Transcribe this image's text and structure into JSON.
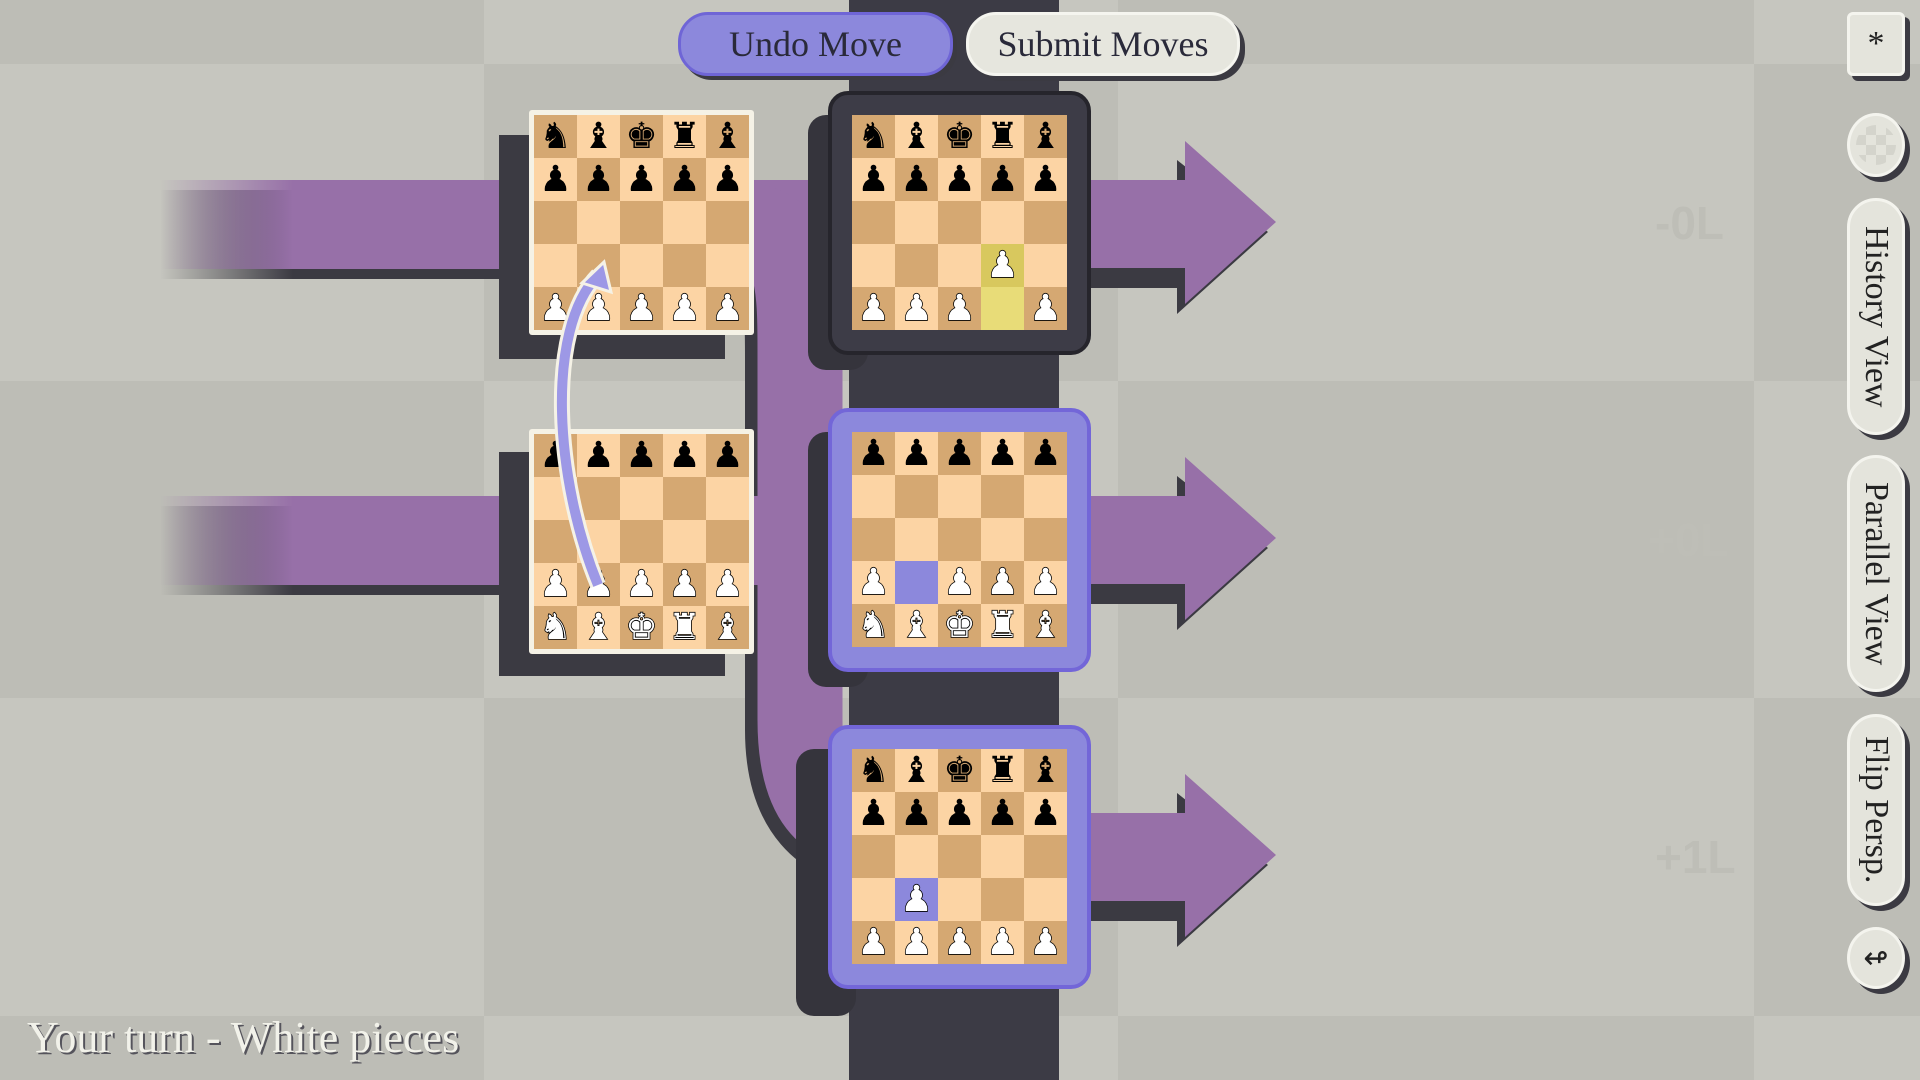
{
  "header": {
    "undo_label": "Undo Move",
    "submit_label": "Submit Moves"
  },
  "sidebar": {
    "asterisk_label": "*",
    "history_label": "History View",
    "parallel_label": "Parallel View",
    "flip_label": "Flip Persp.",
    "back_icon": "back-arrow-icon",
    "circle_icon": "checker-circle-icon"
  },
  "status": {
    "turn_text": "Your turn - White pieces"
  },
  "timelines": [
    {
      "label": "-0L"
    },
    {
      "label": "+0L"
    },
    {
      "label": "+1L"
    }
  ],
  "colors": {
    "light_square": "#fcd4a4",
    "dark_square": "#d5a872",
    "timeline_purple": "#9770a8",
    "selected_purple": "#8c88dc",
    "last_move_from": "#e8dc78",
    "last_move_to": "#d8c85e",
    "active_frame": "#8c88dc",
    "inactive_frame": "#3d3c47"
  },
  "boards": [
    {
      "name": "past-board-top",
      "cells": [
        [
          "bN",
          "bB",
          "bK",
          "bR",
          "bB"
        ],
        [
          "bP",
          "bP",
          "bP",
          "bP",
          "bP"
        ],
        [
          "",
          "",
          "",
          "",
          ""
        ],
        [
          "",
          "",
          "",
          "",
          ""
        ],
        [
          "wP",
          "wP",
          "wP",
          "wP",
          "wP"
        ]
      ],
      "highlights": []
    },
    {
      "name": "past-board-bottom",
      "cells": [
        [
          "bP",
          "bP",
          "bP",
          "bP",
          "bP"
        ],
        [
          "",
          "",
          "",
          "",
          ""
        ],
        [
          "",
          "",
          "",
          "",
          ""
        ],
        [
          "wP",
          "wP",
          "wP",
          "wP",
          "wP"
        ],
        [
          "wN",
          "wB",
          "wK",
          "wR",
          "wB"
        ]
      ],
      "highlights": []
    },
    {
      "name": "present-board-minus0",
      "cells": [
        [
          "bN",
          "bB",
          "bK",
          "bR",
          "bB"
        ],
        [
          "bP",
          "bP",
          "bP",
          "bP",
          "bP"
        ],
        [
          "",
          "",
          "",
          "",
          ""
        ],
        [
          "",
          "",
          "",
          "wP",
          ""
        ],
        [
          "wP",
          "wP",
          "wP",
          "",
          "wP"
        ]
      ],
      "highlights": [
        {
          "r": 3,
          "c": 3,
          "color": "#d8c85e"
        },
        {
          "r": 4,
          "c": 3,
          "color": "#e8dc78"
        }
      ]
    },
    {
      "name": "present-board-plus0",
      "cells": [
        [
          "bP",
          "bP",
          "bP",
          "bP",
          "bP"
        ],
        [
          "",
          "",
          "",
          "",
          ""
        ],
        [
          "",
          "",
          "",
          "",
          ""
        ],
        [
          "wP",
          "",
          "wP",
          "wP",
          "wP"
        ],
        [
          "wN",
          "wB",
          "wK",
          "wR",
          "wB"
        ]
      ],
      "highlights": [
        {
          "r": 3,
          "c": 1,
          "color": "#8c88dc"
        }
      ]
    },
    {
      "name": "present-board-plus1",
      "cells": [
        [
          "bN",
          "bB",
          "bK",
          "bR",
          "bB"
        ],
        [
          "bP",
          "bP",
          "bP",
          "bP",
          "bP"
        ],
        [
          "",
          "",
          "",
          "",
          ""
        ],
        [
          "",
          "wP",
          "",
          "",
          ""
        ],
        [
          "wP",
          "wP",
          "wP",
          "wP",
          "wP"
        ]
      ],
      "highlights": [
        {
          "r": 3,
          "c": 1,
          "color": "#8c88dc"
        }
      ]
    }
  ]
}
